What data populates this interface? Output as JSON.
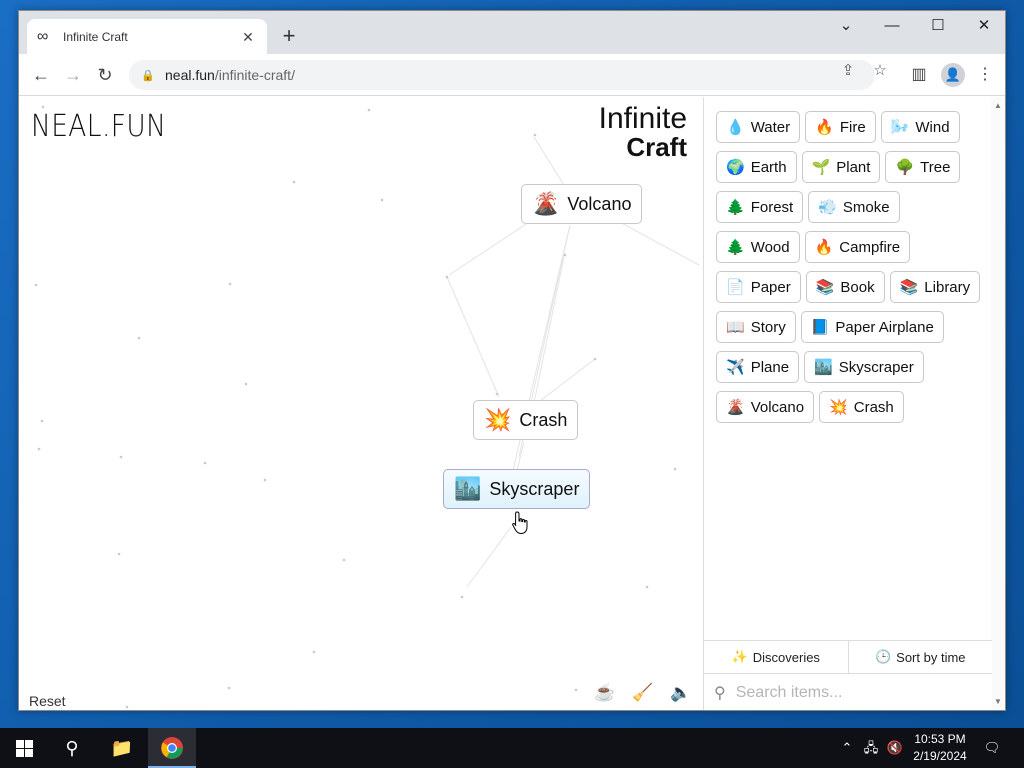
{
  "browser": {
    "tab_title": "Infinite Craft",
    "tab_icon": "infinity-icon",
    "url_host": "neal.fun",
    "url_path": "/infinite-craft/",
    "new_tab_symbol": "+",
    "close_symbol": "✕"
  },
  "canvas": {
    "logo_left": "NEAL.FUN",
    "logo_right_line1": "Infinite",
    "logo_right_line2": "Craft",
    "reset_label": "Reset",
    "items": [
      {
        "emoji": "🌋",
        "label": "Volcano"
      },
      {
        "emoji": "💥",
        "label": "Crash"
      },
      {
        "emoji": "🏙️",
        "label": "Skyscraper",
        "selected": true
      }
    ]
  },
  "sidebar": {
    "items": [
      {
        "emoji": "💧",
        "label": "Water"
      },
      {
        "emoji": "🔥",
        "label": "Fire"
      },
      {
        "emoji": "🌬️",
        "label": "Wind"
      },
      {
        "emoji": "🌍",
        "label": "Earth"
      },
      {
        "emoji": "🌱",
        "label": "Plant"
      },
      {
        "emoji": "🌳",
        "label": "Tree"
      },
      {
        "emoji": "🌲",
        "label": "Forest"
      },
      {
        "emoji": "💨",
        "label": "Smoke"
      },
      {
        "emoji": "🌲",
        "label": "Wood"
      },
      {
        "emoji": "🔥",
        "label": "Campfire"
      },
      {
        "emoji": "📄",
        "label": "Paper"
      },
      {
        "emoji": "📚",
        "label": "Book"
      },
      {
        "emoji": "📚",
        "label": "Library"
      },
      {
        "emoji": "📖",
        "label": "Story"
      },
      {
        "emoji": "📘",
        "label": "Paper Airplane"
      },
      {
        "emoji": "✈️",
        "label": "Plane"
      },
      {
        "emoji": "🏙️",
        "label": "Skyscraper"
      },
      {
        "emoji": "🌋",
        "label": "Volcano"
      },
      {
        "emoji": "💥",
        "label": "Crash"
      }
    ],
    "discoveries_label": "Discoveries",
    "sort_label": "Sort by time",
    "search_placeholder": "Search items..."
  },
  "taskbar": {
    "time": "10:53 PM",
    "date": "2/19/2024"
  }
}
